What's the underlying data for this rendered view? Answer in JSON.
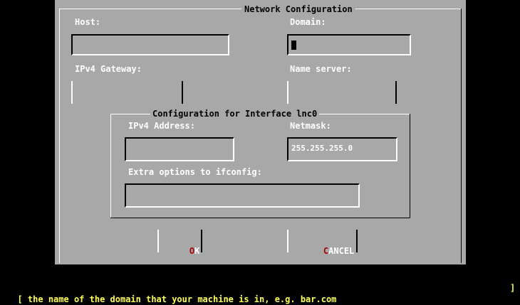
{
  "dialog": {
    "title": "Network Configuration",
    "host_label": "Host:",
    "domain_label": "Domain:",
    "gateway_label": "IPv4 Gateway:",
    "nameserver_label": "Name server:",
    "iface_title": "Configuration for Interface lnc0",
    "ipv4_label": "IPv4 Address:",
    "netmask_label": "Netmask:",
    "netmask_value": "255.255.255.0",
    "extra_label": "Extra options to ifconfig:",
    "ok_label": "OK",
    "ok_hotkey": "O",
    "ok_rest": "K",
    "cancel_hotkey": "C",
    "cancel_rest": "ANCEL"
  },
  "status": {
    "text": "the name of the domain that your machine is in, e.g. bar.com",
    "left_bracket": "[",
    "right_bracket": "]"
  },
  "colors": {
    "background": "#000000",
    "dialog": "#a8a8a8",
    "status_text": "#ffff54",
    "hotkey": "#a80000"
  }
}
